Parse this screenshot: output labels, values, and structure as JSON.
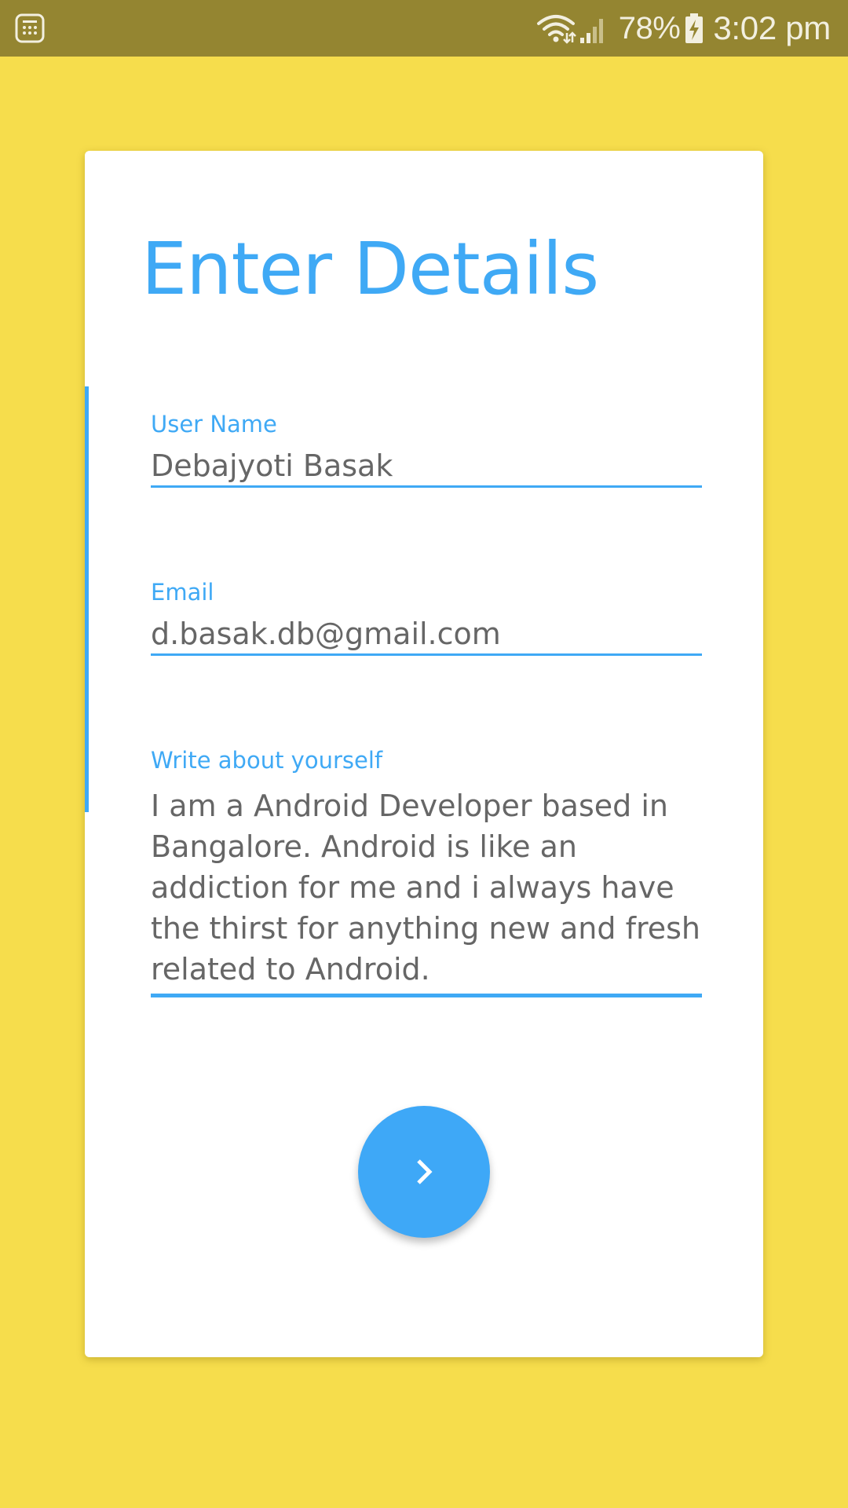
{
  "status_bar": {
    "battery_percent": "78%",
    "time": "3:02 pm",
    "icons": [
      "app-menu-icon",
      "wifi-icon",
      "signal-icon",
      "battery-charging-icon"
    ]
  },
  "form": {
    "title": "Enter Details",
    "username": {
      "label": "User Name",
      "value": "Debajyoti Basak"
    },
    "email": {
      "label": "Email",
      "value": "d.basak.db@gmail.com"
    },
    "about": {
      "label": "Write about yourself",
      "value": "I am a Android Developer based in Bangalore. Android is like an addiction for me and i always have the thirst for anything new and fresh related to Android."
    },
    "next_button": {
      "icon": "chevron-right-icon"
    }
  },
  "colors": {
    "background": "#f6dd4c",
    "status_bar": "#948531",
    "accent": "#3fa9f5",
    "card": "#ffffff",
    "input_text": "#666666"
  }
}
